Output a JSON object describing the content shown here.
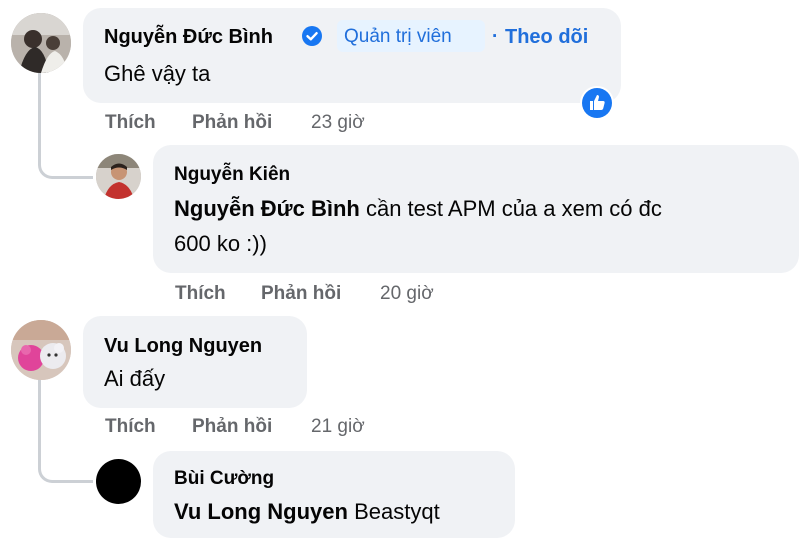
{
  "comments": [
    {
      "author": "Nguyễn Đức Bình",
      "verified_icon": "verified-badge-icon",
      "role_badge": "Quản trị viên",
      "separator": "·",
      "follow_label": "Theo dõi",
      "text": "Ghê vậy ta",
      "reaction_icon": "like-reaction-icon",
      "like_label": "Thích",
      "reply_label": "Phản hồi",
      "time": "23 giờ",
      "reply": {
        "author": "Nguyễn Kiên",
        "mention": "Nguyễn Đức Bình",
        "text_line1": "cần test APM của a xem có đc",
        "text_line2": "600 ko :))",
        "like_label": "Thích",
        "reply_label": "Phản hồi",
        "time": "20 giờ"
      }
    },
    {
      "author": "Vu Long Nguyen",
      "text": "Ai đấy",
      "like_label": "Thích",
      "reply_label": "Phản hồi",
      "time": "21 giờ",
      "reply": {
        "author": "Bùi Cường",
        "mention": "Vu Long Nguyen",
        "text": "Beastyqt"
      }
    }
  ],
  "colors": {
    "bubble": "#f0f2f5",
    "secondary_text": "#65676b",
    "link_blue": "#216fdb",
    "badge_bg": "#e7f3ff",
    "like_blue": "#1877f2",
    "thread_line": "#ccd0d5"
  }
}
